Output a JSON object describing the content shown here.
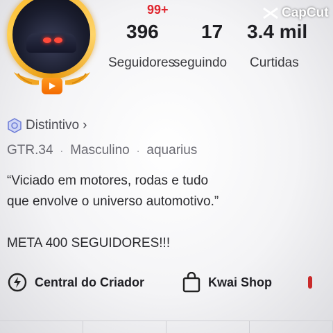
{
  "notification": "99+",
  "stats": [
    {
      "value": "396",
      "label": "Seguidores"
    },
    {
      "value": "17",
      "label": "seguindo"
    },
    {
      "value": "3.4 mil",
      "label": "Curtidas"
    }
  ],
  "watermark": "CapCut",
  "badge": {
    "label": "Distintivo",
    "arrow": "›"
  },
  "info": {
    "username": "GTR.34",
    "gender": "Masculino",
    "sign": "aquarius",
    "separator": "·"
  },
  "bio": {
    "line1": "“Viciado em motores, rodas e tudo",
    "line2": "que envolve o universo automotivo.”"
  },
  "goal": "META 400 SEGUIDORES!!!",
  "actions": [
    {
      "label": "Central do Criador",
      "icon": "lightning-icon"
    },
    {
      "label": "Kwai Shop",
      "icon": "shopping-bag-icon"
    }
  ],
  "colors": {
    "notification": "#e0262e",
    "ring": "#f7b52a"
  }
}
